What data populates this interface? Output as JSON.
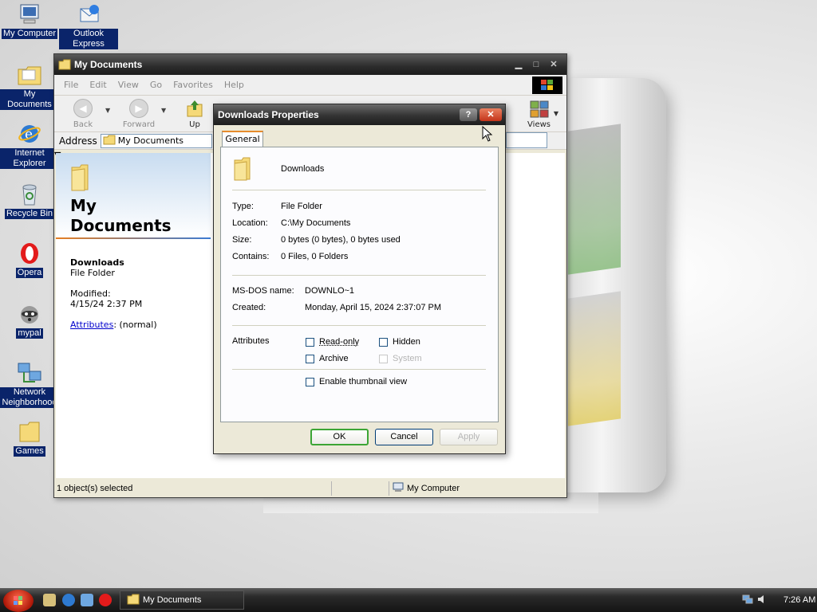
{
  "desktop": {
    "icons": [
      {
        "label": "My Computer"
      },
      {
        "label": "Outlook Express"
      },
      {
        "label": "My Documents"
      },
      {
        "label": "Internet Explorer"
      },
      {
        "label": "Recycle Bin"
      },
      {
        "label": "Opera"
      },
      {
        "label": "mypal"
      },
      {
        "label": "Network Neighborhood"
      },
      {
        "label": "Games"
      }
    ]
  },
  "explorer": {
    "title": "My Documents",
    "menu": [
      "File",
      "Edit",
      "View",
      "Go",
      "Favorites",
      "Help"
    ],
    "toolbar": {
      "back": "Back",
      "forward": "Forward",
      "up": "Up",
      "views": "Views"
    },
    "address": {
      "label": "Address",
      "value": "My Documents"
    },
    "left_pane": {
      "title": "My Documents",
      "item_name": "Downloads",
      "item_type": "File Folder",
      "modified_label": "Modified:",
      "modified_value": "4/15/24 2:37 PM",
      "attributes_link": "Attributes",
      "attributes_value": ": (normal)"
    },
    "status": {
      "selected": "1 object(s) selected",
      "zone": "My Computer"
    }
  },
  "dialog": {
    "title": "Downloads Properties",
    "help_glyph": "?",
    "close_glyph": "✕",
    "tab": "General",
    "folder_name": "Downloads",
    "fields": {
      "type_label": "Type:",
      "type_value": "File Folder",
      "location_label": "Location:",
      "location_value": "C:\\My Documents",
      "size_label": "Size:",
      "size_value": "0 bytes (0 bytes), 0 bytes used",
      "contains_label": "Contains:",
      "contains_value": "0 Files, 0 Folders",
      "msdos_label": "MS-DOS name:",
      "msdos_value": "DOWNLO~1",
      "created_label": "Created:",
      "created_value": "Monday, April 15, 2024 2:37:07 PM"
    },
    "attributes": {
      "label": "Attributes",
      "read_only": "Read-only",
      "hidden": "Hidden",
      "archive": "Archive",
      "system": "System",
      "thumbnail": "Enable thumbnail view"
    },
    "buttons": {
      "ok": "OK",
      "cancel": "Cancel",
      "apply": "Apply"
    }
  },
  "taskbar": {
    "task": "My Documents",
    "clock": "7:26 AM"
  }
}
